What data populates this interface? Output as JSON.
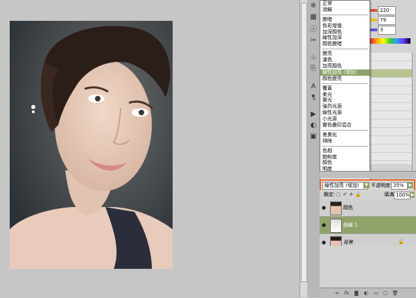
{
  "color_panel": {
    "values": [
      "220",
      "79",
      "3"
    ],
    "bar_colors": [
      "#e0503a",
      "#e5c02a",
      "#5a55d8"
    ]
  },
  "blend_menu": {
    "items_group1": [
      "正常",
      "溶解"
    ],
    "items_group2": [
      "變暗",
      "色彩增值",
      "加深顏色",
      "線性加深",
      "顏色變暗"
    ],
    "items_group3": [
      "變亮",
      "濾色",
      "加亮顏色",
      "線性加亮 (增加)",
      "顏色變亮"
    ],
    "items_group4": [
      "覆蓋",
      "柔光",
      "實光",
      "強烈光源",
      "線性光源",
      "小光源",
      "實色疊印混合"
    ],
    "items_group5": [
      "差異化",
      "排除"
    ],
    "items_group6": [
      "色相",
      "飽和度",
      "顏色",
      "明度"
    ],
    "selected": "線性加亮 (增加)"
  },
  "layers_panel": {
    "blend_mode": "線性加亮 (增加)",
    "opacity_label": "不透明度:",
    "opacity_value": "35%",
    "lock_label": "鎖定:",
    "fill_label": "填滿:",
    "fill_value": "100%",
    "layers": [
      {
        "name": "顏色",
        "visible": true,
        "active": false
      },
      {
        "name": "曲線 1",
        "visible": true,
        "active": true
      },
      {
        "name": "背景",
        "visible": true,
        "active": false,
        "locked": true
      }
    ]
  },
  "icons": {
    "eye": "eye-icon",
    "lock": "lock-icon"
  }
}
